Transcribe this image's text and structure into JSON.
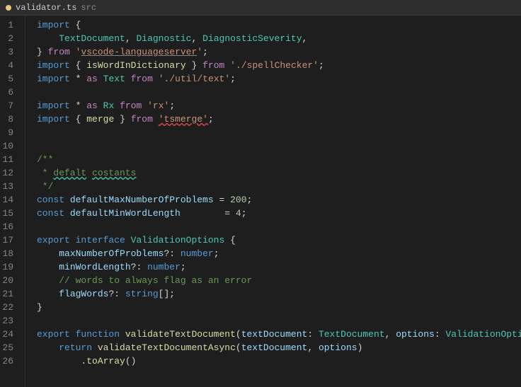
{
  "title": {
    "filename": "validator.ts",
    "section": "src"
  },
  "lines": [
    {
      "num": 1,
      "content": "import_keyword"
    },
    {
      "num": 2,
      "content": "textdocument_line"
    },
    {
      "num": 3,
      "content": "from_vscode"
    },
    {
      "num": 4,
      "content": "import_spell"
    },
    {
      "num": 5,
      "content": "import_text"
    },
    {
      "num": 6,
      "content": "empty"
    },
    {
      "num": 7,
      "content": "import_rx"
    },
    {
      "num": 8,
      "content": "import_tsmerge"
    },
    {
      "num": 9,
      "content": "empty"
    },
    {
      "num": 10,
      "content": "empty"
    },
    {
      "num": 11,
      "content": "jsdoc_open"
    },
    {
      "num": 12,
      "content": "jsdoc_defalt"
    },
    {
      "num": 13,
      "content": "jsdoc_close"
    },
    {
      "num": 14,
      "content": "const_max"
    },
    {
      "num": 15,
      "content": "const_min"
    },
    {
      "num": 16,
      "content": "empty"
    },
    {
      "num": 17,
      "content": "export_interface"
    },
    {
      "num": 18,
      "content": "max_prop"
    },
    {
      "num": 19,
      "content": "min_prop"
    },
    {
      "num": 20,
      "content": "comment_words"
    },
    {
      "num": 21,
      "content": "flagwords_prop"
    },
    {
      "num": 22,
      "content": "close_brace"
    },
    {
      "num": 23,
      "content": "empty"
    },
    {
      "num": 24,
      "content": "export_function"
    },
    {
      "num": 25,
      "content": "return_validate"
    },
    {
      "num": 26,
      "content": "toarray"
    }
  ]
}
